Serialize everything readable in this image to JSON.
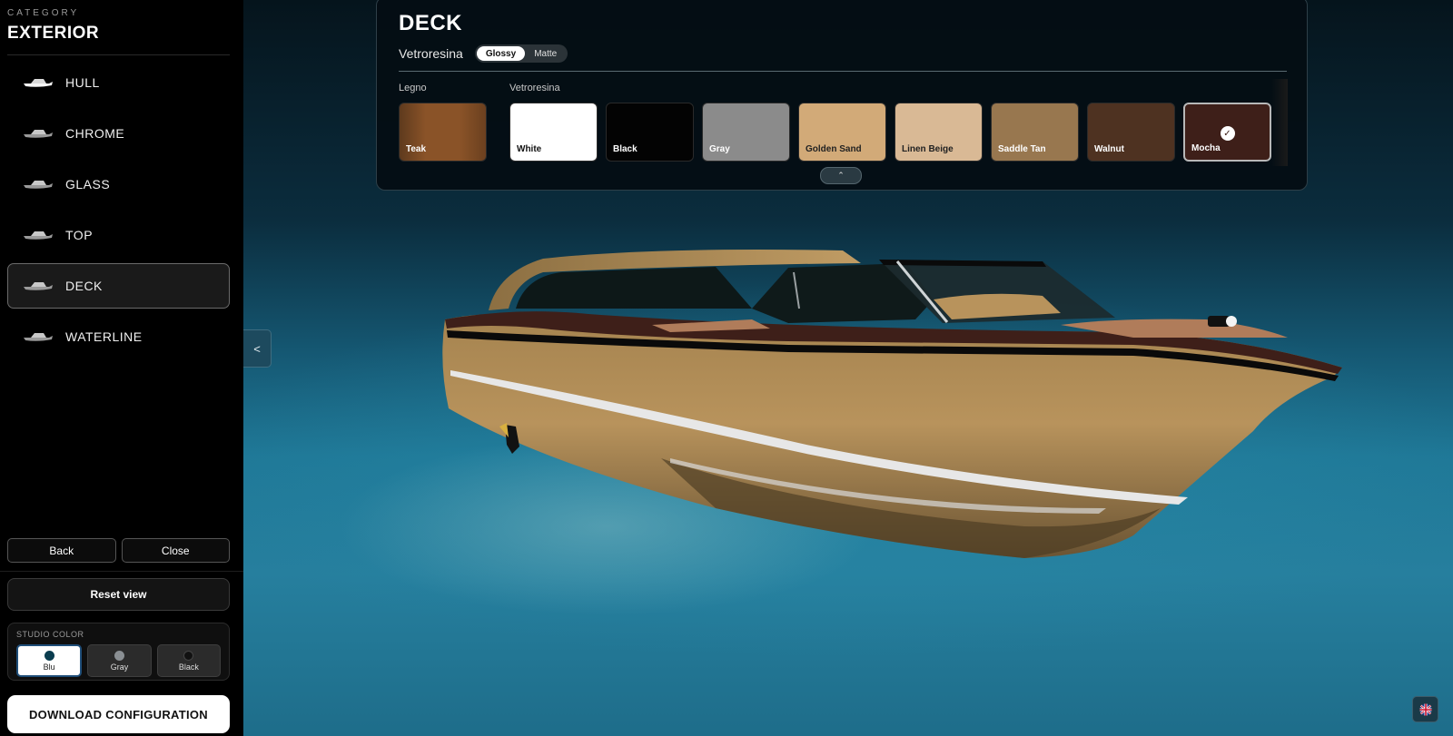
{
  "sidebar": {
    "category_label": "CATEGORY",
    "category_title": "EXTERIOR",
    "items": [
      {
        "label": "HULL",
        "icon": "boat-icon",
        "active": false
      },
      {
        "label": "CHROME",
        "icon": "boat-icon",
        "active": false
      },
      {
        "label": "GLASS",
        "icon": "boat-icon",
        "active": false
      },
      {
        "label": "TOP",
        "icon": "boat-icon",
        "active": false
      },
      {
        "label": "DECK",
        "icon": "boat-icon",
        "active": true
      },
      {
        "label": "WATERLINE",
        "icon": "boat-icon",
        "active": false
      }
    ],
    "back_label": "Back",
    "close_label": "Close",
    "reset_label": "Reset view",
    "studio": {
      "label": "STUDIO COLOR",
      "options": [
        {
          "label": "Blu",
          "color": "#0b3d4f",
          "active": true
        },
        {
          "label": "Gray",
          "color": "#8a8f93",
          "active": false
        },
        {
          "label": "Black",
          "color": "#111111",
          "active": false
        }
      ]
    },
    "download_label": "DOWNLOAD CONFIGURATION"
  },
  "panel": {
    "title": "DECK",
    "finish_label": "Vetroresina",
    "finish_options": [
      {
        "label": "Glossy",
        "active": true
      },
      {
        "label": "Matte",
        "active": false
      }
    ],
    "groups": [
      {
        "label": "Legno"
      },
      {
        "label": "Vetroresina"
      }
    ],
    "swatches": [
      {
        "name": "Teak",
        "color": "#8a5328",
        "text_color": "#ffffff",
        "selected": false
      },
      {
        "name": "White",
        "color": "#ffffff",
        "text_color": "#111111",
        "selected": false
      },
      {
        "name": "Black",
        "color": "#030303",
        "text_color": "#ffffff",
        "selected": false
      },
      {
        "name": "Gray",
        "color": "#8b8b8b",
        "text_color": "#ffffff",
        "selected": false
      },
      {
        "name": "Golden Sand",
        "color": "#d2aa78",
        "text_color": "#222222",
        "selected": false
      },
      {
        "name": "Linen Beige",
        "color": "#d9b995",
        "text_color": "#222222",
        "selected": false
      },
      {
        "name": "Saddle Tan",
        "color": "#98774f",
        "text_color": "#ffffff",
        "selected": false
      },
      {
        "name": "Walnut",
        "color": "#4e3221",
        "text_color": "#ffffff",
        "selected": false
      },
      {
        "name": "Mocha",
        "color": "#3e1f19",
        "text_color": "#ffffff",
        "selected": true
      }
    ],
    "collapse_glyph": "⌃"
  },
  "viewport": {
    "collapse_sidebar_glyph": "<",
    "language_icon": "uk-flag-icon"
  }
}
